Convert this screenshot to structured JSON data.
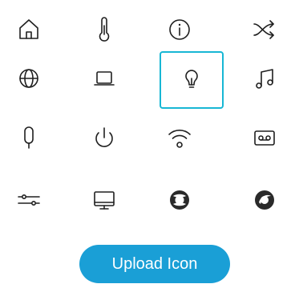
{
  "icons": [
    {
      "name": "home-icon"
    },
    {
      "name": "thermometer-icon"
    },
    {
      "name": "info-icon"
    },
    {
      "name": "shuffle-icon"
    },
    {
      "name": "globe-icon"
    },
    {
      "name": "laptop-icon"
    },
    {
      "name": "lightbulb-icon",
      "selected": true
    },
    {
      "name": "music-note-icon"
    },
    {
      "name": "microphone-icon"
    },
    {
      "name": "power-icon"
    },
    {
      "name": "wifi-icon"
    },
    {
      "name": "voicemail-icon"
    },
    {
      "name": "sliders-icon"
    },
    {
      "name": "monitor-icon"
    },
    {
      "name": "webex-teams-icon"
    },
    {
      "name": "webex-logo-icon"
    }
  ],
  "colors": {
    "accent": "#17b7d4",
    "button": "#1a9fd6",
    "icon": "#1f1f1f"
  },
  "upload_button": {
    "label": "Upload Icon"
  }
}
